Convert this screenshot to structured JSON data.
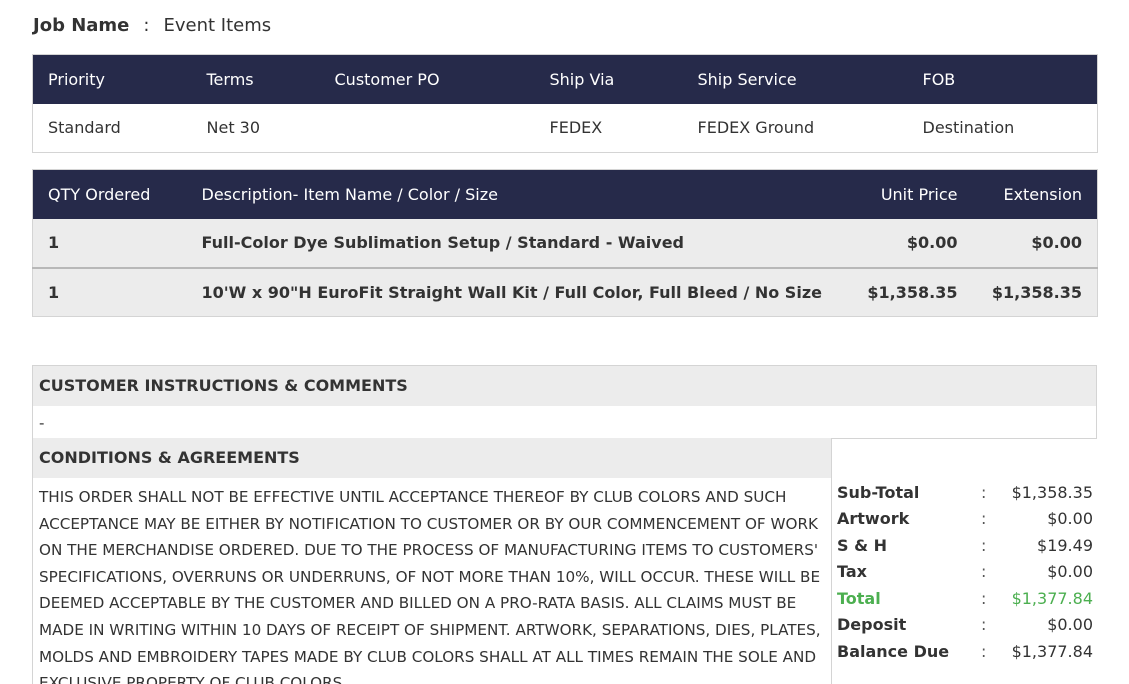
{
  "job": {
    "label": "Job Name",
    "colon": ":",
    "value": "Event Items"
  },
  "order_info": {
    "headers": [
      "Priority",
      "Terms",
      "Customer PO",
      "Ship Via",
      "Ship Service",
      "FOB"
    ],
    "values": [
      "Standard",
      "Net 30",
      "",
      "FEDEX",
      "FEDEX Ground",
      "Destination"
    ]
  },
  "items": {
    "headers": [
      "QTY Ordered",
      "Description- Item Name / Color / Size",
      "Unit Price",
      "Extension"
    ],
    "rows": [
      {
        "qty": "1",
        "description": "Full-Color Dye Sublimation Setup / Standard - Waived",
        "unit_price": "$0.00",
        "extension": "$0.00"
      },
      {
        "qty": "1",
        "description": "10'W x 90\"H EuroFit Straight Wall Kit / Full Color, Full Bleed / No Size",
        "unit_price": "$1,358.35",
        "extension": "$1,358.35"
      }
    ]
  },
  "customer_instructions": {
    "title": "CUSTOMER INSTRUCTIONS & COMMENTS",
    "body": "-"
  },
  "conditions": {
    "title": "CONDITIONS & AGREEMENTS",
    "text": "THIS ORDER SHALL NOT BE EFFECTIVE UNTIL ACCEPTANCE THEREOF BY CLUB COLORS AND SUCH ACCEPTANCE MAY BE EITHER BY NOTIFICATION TO CUSTOMER OR BY OUR COMMENCEMENT OF WORK ON THE MERCHANDISE ORDERED. DUE TO THE PROCESS OF MANUFACTURING ITEMS TO CUSTOMERS' SPECIFICATIONS, OVERRUNS OR UNDERRUNS, OF NOT MORE THAN 10%, WILL OCCUR. THESE WILL BE DEEMED ACCEPTABLE BY THE CUSTOMER AND BILLED ON A PRO-RATA BASIS. ALL CLAIMS MUST BE MADE IN WRITING WITHIN 10 DAYS OF RECEIPT OF SHIPMENT. ARTWORK, SEPARATIONS, DIES, PLATES, MOLDS AND EMBROIDERY TAPES MADE BY CLUB COLORS SHALL AT ALL TIMES REMAIN THE SOLE AND EXCLUSIVE PROPERTY OF CLUB COLORS."
  },
  "totals": {
    "colon": ":",
    "rows": [
      {
        "label": "Sub-Total",
        "value": "$1,358.35"
      },
      {
        "label": "Artwork",
        "value": "$0.00"
      },
      {
        "label": "S & H",
        "value": "$19.49"
      },
      {
        "label": "Tax",
        "value": "$0.00"
      },
      {
        "label": "Total",
        "value": "$1,377.84"
      },
      {
        "label": "Deposit",
        "value": "$0.00"
      },
      {
        "label": "Balance Due",
        "value": "$1,377.84"
      }
    ],
    "highlight_color": "#4caf50"
  },
  "colors": {
    "header_bg": "#262a4a",
    "row_bg": "#ececec"
  }
}
